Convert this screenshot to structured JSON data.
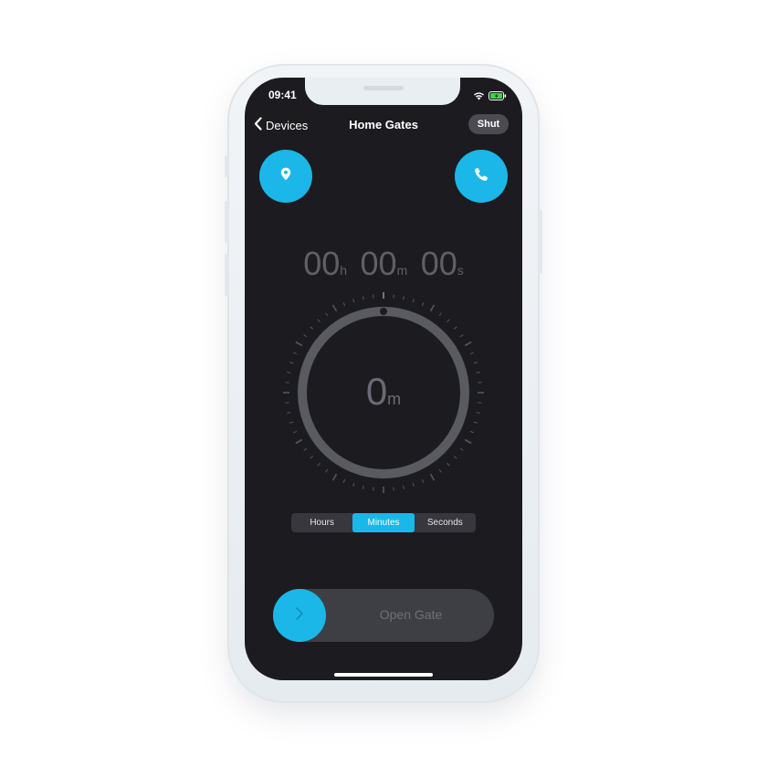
{
  "status_bar": {
    "time": "09:41",
    "wifi_icon": "wifi-icon",
    "battery_icon": "battery-charging-icon",
    "battery_color": "#3ed34a"
  },
  "nav": {
    "back_label": "Devices",
    "title": "Home Gates",
    "shut_label": "Shut"
  },
  "actions": {
    "location_icon": "location-pin-icon",
    "call_icon": "phone-icon",
    "accent_color": "#1bb7e8"
  },
  "timer": {
    "hours": "00",
    "hours_unit": "h",
    "minutes": "00",
    "minutes_unit": "m",
    "seconds": "00",
    "seconds_unit": "s",
    "dial_value": "0",
    "dial_unit": "m"
  },
  "segmented": {
    "options": [
      "Hours",
      "Minutes",
      "Seconds"
    ],
    "selected": "Minutes"
  },
  "slider": {
    "label": "Open Gate",
    "knob_icon": "chevron-right-icon",
    "progress": 0
  }
}
